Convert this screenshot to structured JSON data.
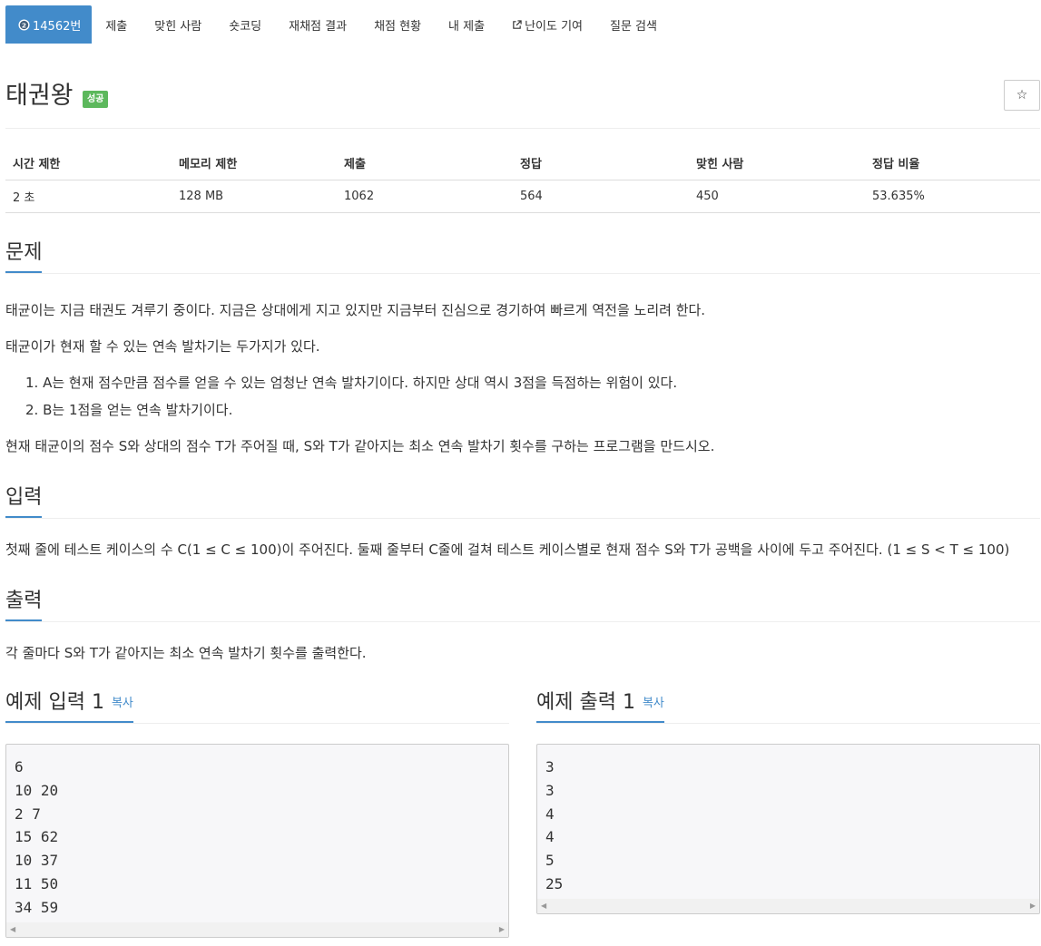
{
  "nav": {
    "problem_tab": "14562번",
    "tabs": [
      "제출",
      "맞힌 사람",
      "숏코딩",
      "재채점 결과",
      "채점 현황",
      "내 제출",
      "난이도 기여",
      "질문 검색"
    ]
  },
  "problem": {
    "title": "태권왕",
    "status_badge": "성공",
    "star_glyph": "☆"
  },
  "info": {
    "headers": [
      "시간 제한",
      "메모리 제한",
      "제출",
      "정답",
      "맞힌 사람",
      "정답 비율"
    ],
    "values": [
      "2 초",
      "128 MB",
      "1062",
      "564",
      "450",
      "53.635%"
    ]
  },
  "description": {
    "heading": "문제",
    "p1": "태균이는 지금 태권도 겨루기 중이다. 지금은 상대에게 지고 있지만 지금부터 진심으로 경기하여 빠르게 역전을 노리려 한다.",
    "p2": "태균이가 현재 할 수 있는 연속 발차기는 두가지가 있다.",
    "items": [
      "1. A는 현재 점수만큼 점수를 얻을 수 있는 엄청난 연속 발차기이다. 하지만 상대 역시 3점을 득점하는 위험이 있다.",
      "2. B는 1점을 얻는 연속 발차기이다."
    ],
    "p3": "현재 태균이의 점수 S와 상대의 점수 T가 주어질 때, S와 T가 같아지는 최소 연속 발차기 횟수를 구하는 프로그램을 만드시오."
  },
  "input_section": {
    "heading": "입력",
    "text": "첫째 줄에 테스트 케이스의 수 C(1 ≤ C ≤ 100)이 주어진다. 둘째 줄부터 C줄에 걸쳐 테스트 케이스별로 현재 점수 S와 T가 공백을 사이에 두고 주어진다. (1 ≤ S < T ≤ 100)"
  },
  "output_section": {
    "heading": "출력",
    "text": "각 줄마다 S와 T가 같아지는 최소 연속 발차기 횟수를 출력한다."
  },
  "sample_input": {
    "heading": "예제 입력 1",
    "copy_label": "복사",
    "content": "6\n10 20\n2 7\n15 62\n10 37\n11 50\n34 59"
  },
  "sample_output": {
    "heading": "예제 출력 1",
    "copy_label": "복사",
    "content": "3\n3\n4\n4\n5\n25"
  },
  "colors": {
    "accent": "#428bca",
    "success": "#5cb85c"
  }
}
